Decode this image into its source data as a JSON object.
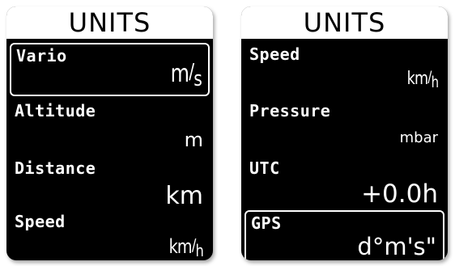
{
  "screens": [
    {
      "title": "UNITS",
      "rows": [
        {
          "label": "Vario",
          "unit_num": "m",
          "unit_den": "s"
        },
        {
          "label": "Altitude",
          "value": "m"
        },
        {
          "label": "Distance",
          "value": "km"
        },
        {
          "label": "Speed",
          "unit_num": "km",
          "unit_den": "h"
        }
      ]
    },
    {
      "title": "UNITS",
      "rows": [
        {
          "label": "Speed",
          "unit_num": "km",
          "unit_den": "h"
        },
        {
          "label": "Pressure",
          "value": "mbar"
        },
        {
          "label": "UTC",
          "value": "+0.0h"
        },
        {
          "label": "GPS",
          "value": "d°m's\""
        }
      ]
    }
  ],
  "colors": {
    "screen_bg": "#000000",
    "header_bg": "#ffffff",
    "text": "#ffffff",
    "selection_border": "#ffffff"
  }
}
